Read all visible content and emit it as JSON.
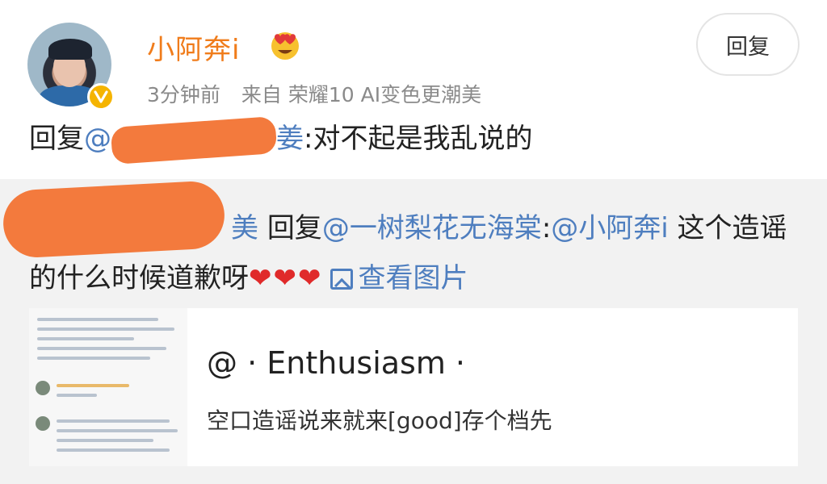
{
  "post": {
    "username": "小阿奔i",
    "time": "3分钟前",
    "source": "来自 荣耀10 AI变色更潮美",
    "reply_button": "回复",
    "content_prefix": "回复",
    "mention_start": "@",
    "mention_tail": "姜",
    "content_text": ":对不起是我乱说的"
  },
  "quote": {
    "name_tail": "美",
    "reply_word": "回复",
    "mention_1": "@一树梨花无海棠",
    "colon": ":",
    "mention_2": "@小阿奔i",
    "text_1": " 这个造谣的什么时候道歉呀",
    "hearts": "❤❤❤",
    "view_image": "查看图片"
  },
  "card": {
    "title": "@ · Enthusiasm ·",
    "description": "空口造谣说来就来[good]存个档先"
  },
  "colors": {
    "username": "#f07c1b",
    "link": "#4e7ebf",
    "redaction": "#f37a3d",
    "verified_badge": "#f5b400",
    "heart": "#e02a2a"
  },
  "icons": [
    "verified-badge-icon",
    "heart-eyes-emoji-icon",
    "image-icon"
  ]
}
